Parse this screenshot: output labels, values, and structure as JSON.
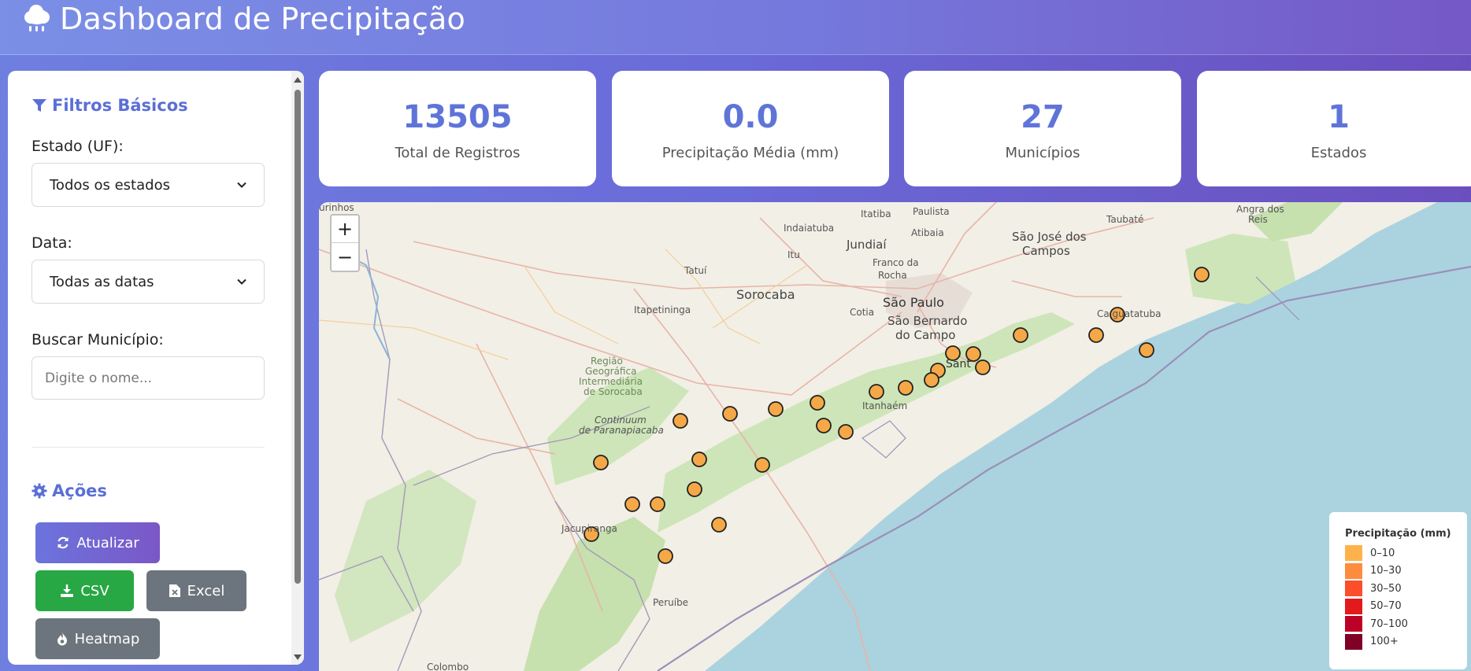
{
  "header": {
    "title": "Dashboard de Precipitação",
    "icon": "cloud-rain-icon"
  },
  "sidebar": {
    "filters_title": "Filtros Básicos",
    "state_label": "Estado (UF):",
    "state_value": "Todos os estados",
    "date_label": "Data:",
    "date_value": "Todas as datas",
    "search_label": "Buscar Município:",
    "search_placeholder": "Digite o nome...",
    "actions_title": "Ações",
    "buttons": {
      "update": "Atualizar",
      "csv": "CSV",
      "excel": "Excel",
      "heatmap": "Heatmap"
    }
  },
  "stats": [
    {
      "value": "13505",
      "label": "Total de Registros"
    },
    {
      "value": "0.0",
      "label": "Precipitação Média (mm)"
    },
    {
      "value": "27",
      "label": "Municípios"
    },
    {
      "value": "1",
      "label": "Estados"
    }
  ],
  "map": {
    "zoom_in": "+",
    "zoom_out": "−",
    "labels": {
      "sao_paulo": "São Paulo",
      "sao_bernardo": "São Bernardo",
      "do_campo": "do Campo",
      "sorocaba": "Sorocaba",
      "jundiai": "Jundiaí",
      "sao_jose": "São José dos",
      "campos": "Campos",
      "itapetininga": "Itapetininga",
      "tatui": "Tatuí",
      "cotia": "Cotia",
      "itu": "Itu",
      "indaiatuba": "Indaiatuba",
      "itatiba": "Itatiba",
      "atibaia": "Atibaia",
      "paulista": "Paulista",
      "franco": "Franco da",
      "rocha": "Rocha",
      "taubate": "Taubaté",
      "itanhaem": "Itanhaém",
      "santos": "Sant",
      "caraguatatuba": "Ca  guatatuba",
      "regiao": "Região",
      "geografica": "Geográfica",
      "intermediaria": "Intermediária",
      "de_sorocaba": "de Sorocaba",
      "continuum": "Continuum",
      "de_paranapiacaba": "de Paranapiacaba",
      "colombo": "Colombo",
      "angra": "Angra dos",
      "reis": "Reis",
      "jacupiranga": "Jacupiranga",
      "peruibe": "Peruíbe",
      "surinhos": "urinhos"
    },
    "legend": {
      "title": "Precipitação (mm)",
      "items": [
        {
          "label": "0–10",
          "color": "#feb24c"
        },
        {
          "label": "10–30",
          "color": "#fd8d3c"
        },
        {
          "label": "30–50",
          "color": "#fc4e2a"
        },
        {
          "label": "50–70",
          "color": "#e31a1c"
        },
        {
          "label": "70–100",
          "color": "#bd0026"
        },
        {
          "label": "100+",
          "color": "#800026"
        }
      ]
    },
    "marker_color": "#f5a847"
  }
}
